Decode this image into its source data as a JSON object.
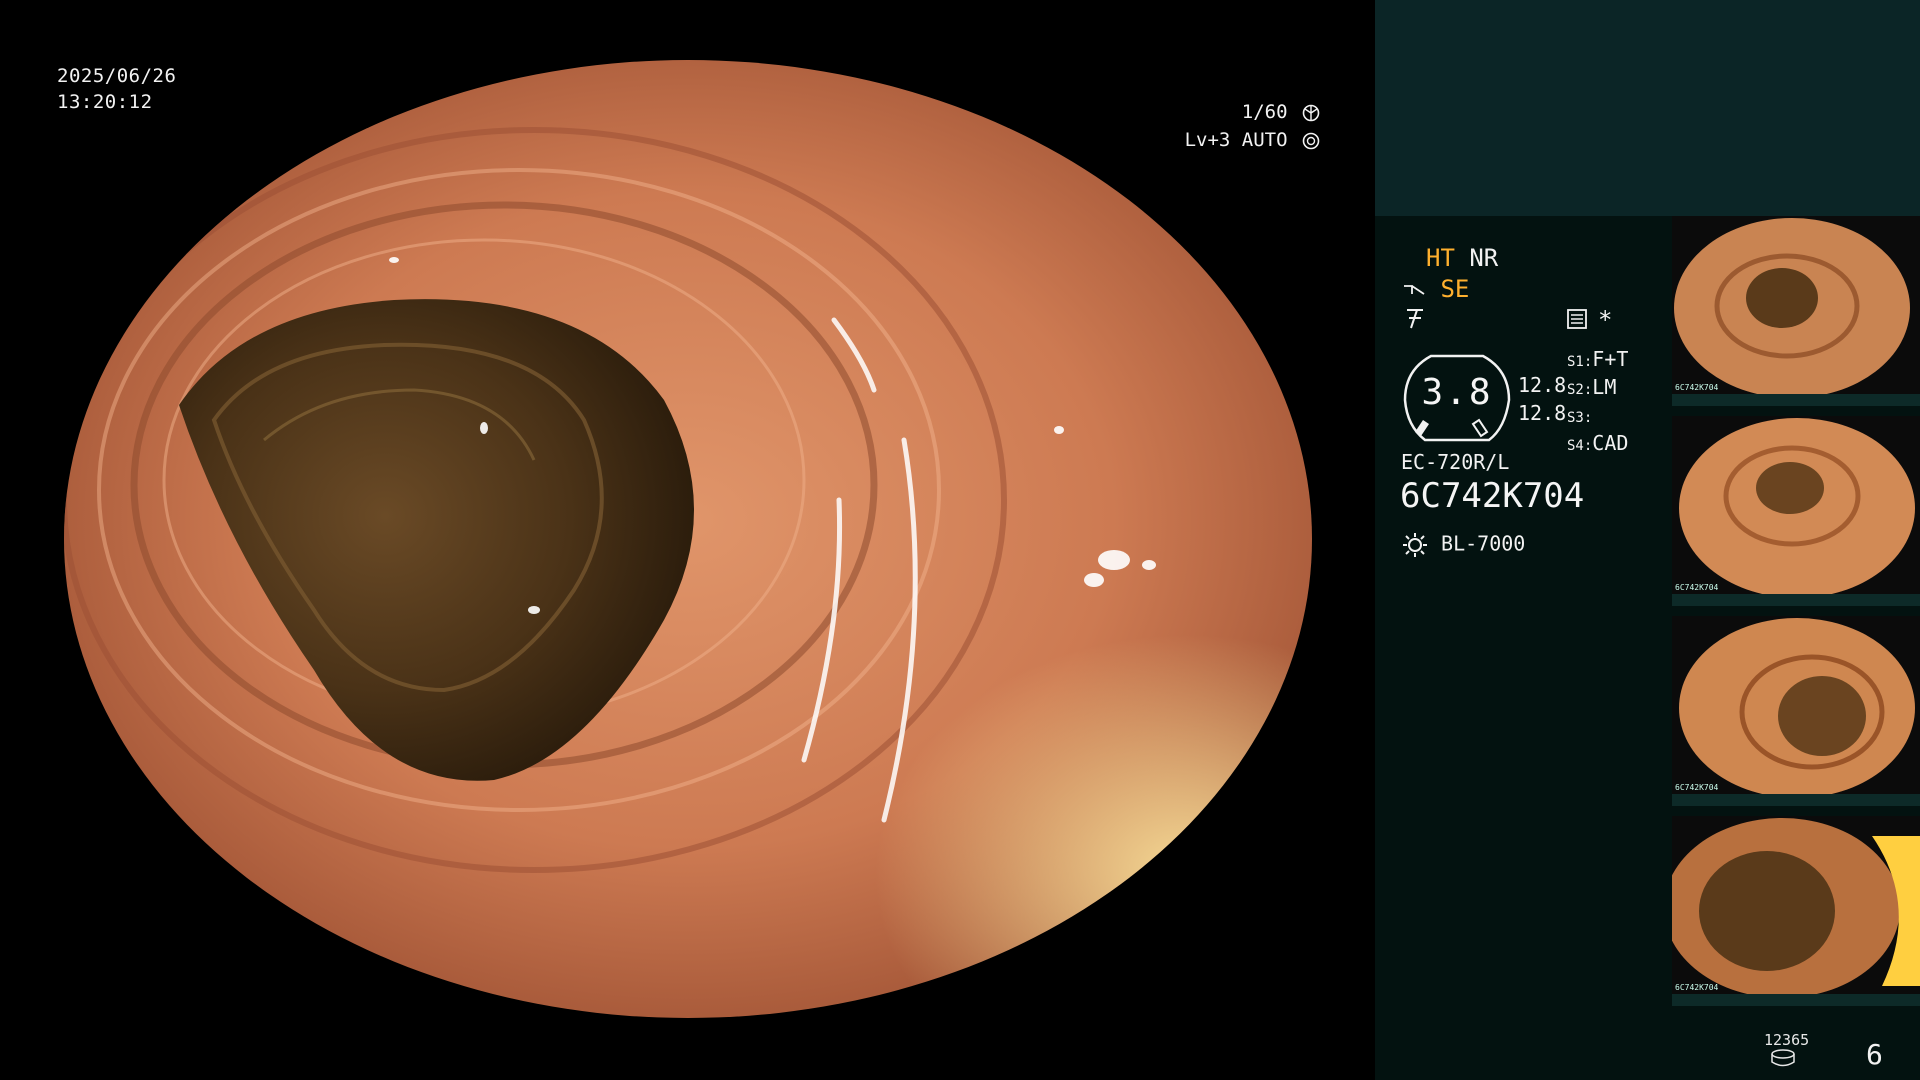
{
  "overlay": {
    "date": "2025/06/26",
    "time": "13:20:12",
    "shutter": "1/60",
    "level_mode": "Lv+3 AUTO"
  },
  "panel": {
    "mode_ht": "HT",
    "mode_nr": "NR",
    "mode_se": "SE",
    "gauge_value": "3.8",
    "gauge_side_top": "12.8",
    "gauge_side_bottom": "12.8",
    "asterisk": "*",
    "s_settings": [
      {
        "key": "S1:",
        "value": "F+T"
      },
      {
        "key": "S2:",
        "value": "LM"
      },
      {
        "key": "S3:",
        "value": ""
      },
      {
        "key": "S4:",
        "value": "CAD"
      }
    ],
    "scope_model": "EC-720R/L",
    "scope_serial": "6C742K704",
    "light_source": "BL-7000",
    "image_counter": "12365",
    "page_number": "6"
  },
  "thumbnails": [
    {
      "label": "6C742K704"
    },
    {
      "label": "6C742K704"
    },
    {
      "label": "6C742K704"
    },
    {
      "label": "6C742K704"
    }
  ],
  "colors": {
    "panel_bg": "#031210",
    "panel_header": "#0b2526",
    "accent_orange": "#ffb02e",
    "tissue": "#c9774f"
  }
}
